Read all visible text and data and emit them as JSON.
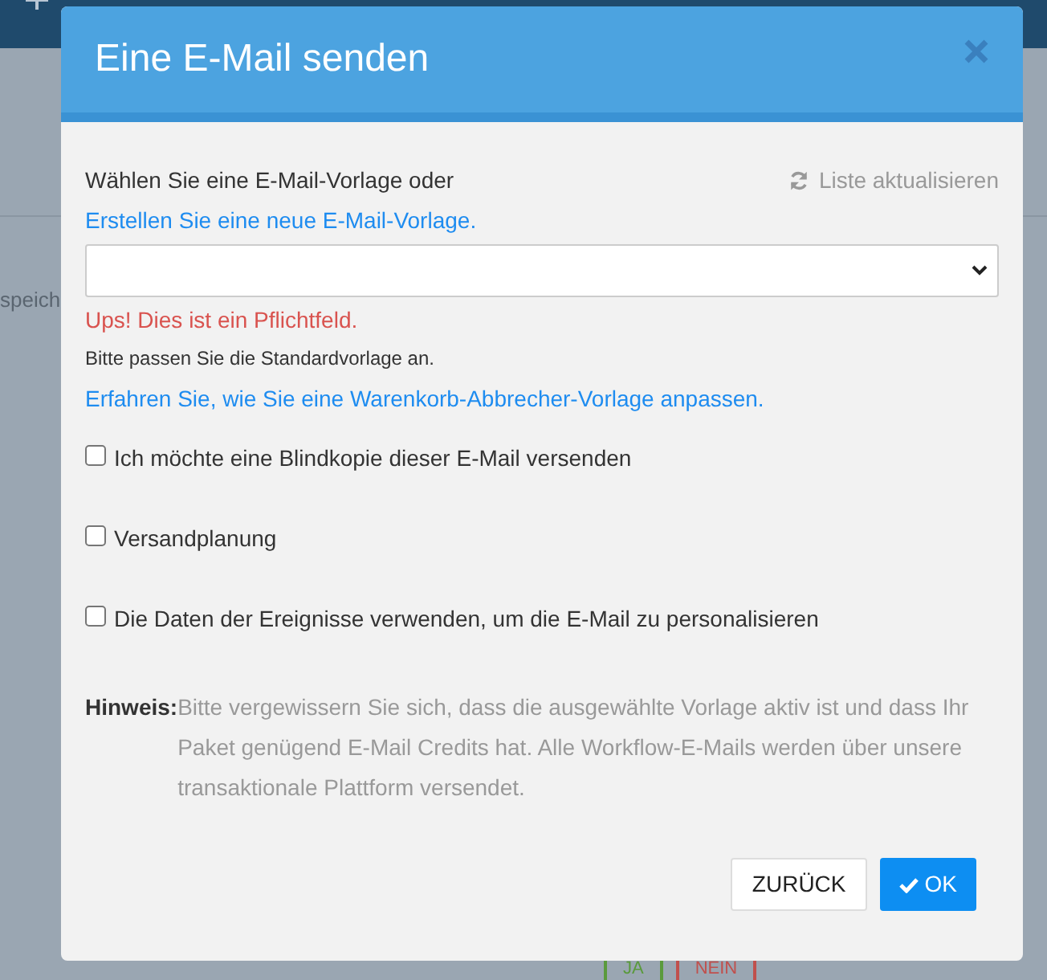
{
  "background": {
    "partial_text": "speich",
    "branches": [
      {
        "label": "JA",
        "color": "#5a9a3c"
      },
      {
        "label": "NEIN",
        "color": "#c0504d"
      }
    ]
  },
  "dialog": {
    "title": "Eine E-Mail senden",
    "refresh_link": "Liste aktualisieren",
    "intro": "Wählen Sie eine E-Mail-Vorlage oder",
    "intro_link": "Erstellen Sie eine neue E-Mail-Vorlage.",
    "error": "Ups! Dies ist ein Pflichtfeld.",
    "help": "Bitte passen Sie die Standardvorlage an.",
    "help_link": "Erfahren Sie, wie Sie eine Warenkorb-Abbrecher-Vorlage anpassen.",
    "options": [
      {
        "label": "Ich möchte eine Blindkopie dieser E-Mail versenden",
        "checked": false
      },
      {
        "label": "Versandplanung",
        "checked": false
      },
      {
        "label": "Die Daten der Ereignisse verwenden, um die E-Mail zu personalisieren",
        "checked": false
      }
    ],
    "hint_label": "Hinweis:",
    "hint": "Bitte vergewissern Sie sich, dass die ausgewählte Vorlage aktiv ist und dass Ihr Paket genügend E-Mail Credits hat. Alle Workflow-E-Mails werden über unsere transaktionale Plattform versendet.",
    "buttons": [
      {
        "label": "ZURÜCK",
        "kind": "secondary"
      },
      {
        "label": "OK",
        "kind": "primary"
      }
    ]
  }
}
